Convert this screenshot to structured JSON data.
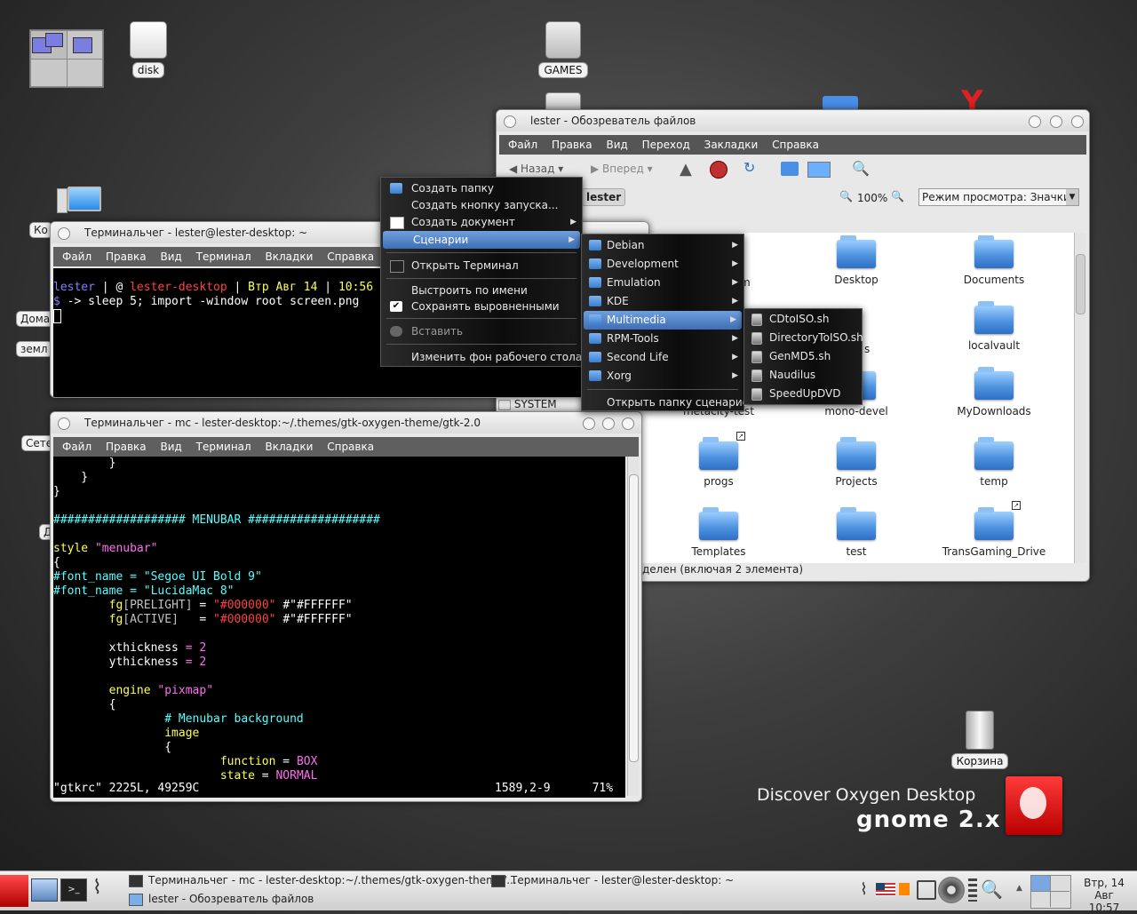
{
  "desktop": {
    "icons": {
      "disk": "disk",
      "games": "GAMES",
      "trash": "Корзина",
      "side_1": "Ко",
      "side_2": "Дома",
      "side_3": "земл",
      "side_4": "Сете",
      "side_5": "Д"
    },
    "branding": {
      "line1": "Discover Oxygen Desktop",
      "line2": "gnome 2.x"
    }
  },
  "file_manager": {
    "title": "lester - Обозреватель файлов",
    "menu": [
      "Файл",
      "Правка",
      "Вид",
      "Переход",
      "Закладки",
      "Справка"
    ],
    "toolbar": {
      "back": "Назад",
      "forward": "Вперед"
    },
    "location": "lester",
    "zoom": "100%",
    "view_mode": "Режим просмотра: Значки",
    "side_label": "SYSTEM",
    "partial_left": "m",
    "partial_left2": "s",
    "items": [
      {
        "name": "Desktop"
      },
      {
        "name": "Documents"
      },
      {
        "name": "localvault"
      },
      {
        "name": "metacity-test"
      },
      {
        "name": "mono-devel"
      },
      {
        "name": "MyDownloads"
      },
      {
        "name": "progs"
      },
      {
        "name": "Projects"
      },
      {
        "name": "temp"
      },
      {
        "name": "Templates"
      },
      {
        "name": "test"
      },
      {
        "name": "TransGaming_Drive"
      }
    ],
    "status": "делен (включая 2 элемента)"
  },
  "terminal1": {
    "title": "Терминальчег - lester@lester-desktop: ~",
    "menu": [
      "Файл",
      "Правка",
      "Вид",
      "Терминал",
      "Вкладки",
      "Справка"
    ],
    "prompt_user": "lester",
    "prompt_sep1": " | @ ",
    "prompt_host": "lester-desktop",
    "prompt_sep2": " | ",
    "prompt_date": "Втр Авг 14",
    "prompt_sep3": " | ",
    "prompt_time": "10:56",
    "cmd_dollar": "$",
    "cmd": " -> sleep 5; import -window root screen.png"
  },
  "terminal2": {
    "title": "Терминальчег - mc - lester-desktop:~/.themes/gtk-oxygen-theme/gtk-2.0",
    "menu": [
      "Файл",
      "Правка",
      "Вид",
      "Терминал",
      "Вкладки",
      "Справка"
    ],
    "l1": "        }",
    "l2": "    }",
    "l3": "}",
    "l4": "################### MENUBAR ###################",
    "l5_kw": "style",
    "l5_str": " \"menubar\"",
    "l6": "{",
    "l7": "#font_name = \"Segoe UI Bold 9\"",
    "l8": "#font_name = \"LucidaMac 8\"",
    "l9_a": "        fg",
    "l9_b": "[PRELIGHT]",
    "l9_c": " = ",
    "l9_d": "\"#000000\"",
    "l9_e": " #\"#FFFFFF\"",
    "l10_a": "        fg",
    "l10_b": "[ACTIVE]",
    "l10_c": "   = ",
    "l10_d": "\"#000000\"",
    "l10_e": " #\"#FFFFFF\"",
    "l11_a": "        xthickness",
    "l11_b": " = 2",
    "l12_a": "        ythickness",
    "l12_b": " = 2",
    "l13_a": "        engine",
    "l13_b": " \"pixmap\"",
    "l14": "        {",
    "l15": "                # Menubar background",
    "l16": "                image",
    "l17": "                {",
    "l18_a": "                        function",
    "l18_b": " = ",
    "l18_c": "BOX",
    "l19_a": "                        state",
    "l19_b": " = ",
    "l19_c": "NORMAL",
    "status_left": "\"gtkrc\" 2225L, 49259C",
    "status_pos": "1589,2-9",
    "status_pct": "71%"
  },
  "context_menu": {
    "items": [
      {
        "label": "Создать папку"
      },
      {
        "label": "Создать кнопку запуска..."
      },
      {
        "label": "Создать документ"
      },
      {
        "label": "Сценарии"
      },
      {
        "label": "Открыть Терминал"
      },
      {
        "label": "Выстроить по имени"
      },
      {
        "label": "Сохранять выровненными"
      },
      {
        "label": "Вставить"
      },
      {
        "label": "Изменить фон рабочего стола"
      }
    ]
  },
  "scripts_menu": {
    "items": [
      "Debian",
      "Development",
      "Emulation",
      "KDE",
      "Multimedia",
      "RPM-Tools",
      "Second Life",
      "Xorg"
    ],
    "open_folder": "Открыть папку сценариев"
  },
  "multimedia_menu": {
    "items": [
      "CDtoISO.sh",
      "DirectoryToISO.sh",
      "GenMD5.sh",
      "Naudilus",
      "SpeedUpDVD"
    ]
  },
  "taskbar": {
    "task1": "Терминальчег - mc - lester-desktop:~/.themes/gtk-oxygen-theme/...",
    "task2": "Терминальчег - lester@lester-desktop: ~",
    "task3": "lester - Обозреватель файлов",
    "clock_date": "Втр, 14 Авг",
    "clock_time": "10:57"
  }
}
